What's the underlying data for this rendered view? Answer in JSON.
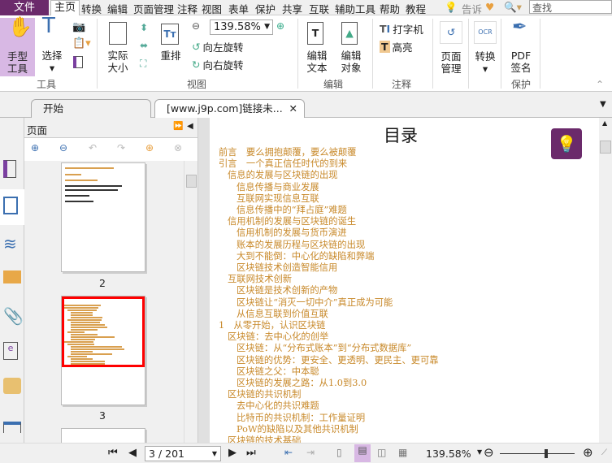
{
  "menu": {
    "file": "文件",
    "home": "主页",
    "items": [
      "转换",
      "编辑",
      "页面管理",
      "注释",
      "视图",
      "表单",
      "保护",
      "共享",
      "互联",
      "辅助工具",
      "帮助",
      "教程"
    ],
    "tell": "告诉",
    "search_placeholder": "查找"
  },
  "ribbon": {
    "hand": "手型工具",
    "select": "选择",
    "group_tools": "工具",
    "actual_size": "实际大小",
    "reflow": "重排",
    "zoom_value": "139.58%",
    "rotate_left": "向左旋转",
    "rotate_right": "向右旋转",
    "group_view": "视图",
    "edit_text": "编辑文本",
    "edit_object": "编辑对象",
    "group_edit": "编辑",
    "typewriter": "打字机",
    "highlight": "高亮",
    "group_comment": "注释",
    "page_manage": "页面管理",
    "convert": "转换",
    "pdf_sign_1": "PDF",
    "pdf_sign_2": "签名",
    "group_protect": "保护"
  },
  "tabs": [
    {
      "label": "开始"
    },
    {
      "label": "[www.j9p.com]链接未..."
    }
  ],
  "panel": {
    "title": "页面",
    "thumbs": [
      {
        "label": "2"
      },
      {
        "label": "3"
      }
    ]
  },
  "doc": {
    "title": "目录",
    "toc": [
      {
        "t": "前言　要么拥抱颠覆，要么被颠覆",
        "l": 0
      },
      {
        "t": "引言　一个真正信任时代的到来",
        "l": 0
      },
      {
        "t": "信息的发展与区块链的出现",
        "l": 1
      },
      {
        "t": "信息传播与商业发展",
        "l": 2
      },
      {
        "t": "互联网实现信息互联",
        "l": 2
      },
      {
        "t": "信息传播中的“拜占庭”难题",
        "l": 2
      },
      {
        "t": "信用机制的发展与区块链的诞生",
        "l": 1
      },
      {
        "t": "信用机制的发展与货币演进",
        "l": 2
      },
      {
        "t": "账本的发展历程与区块链的出现",
        "l": 2
      },
      {
        "t": "大到不能倒：中心化的缺陷和弊端",
        "l": 2
      },
      {
        "t": "区块链技术创造智能信用",
        "l": 2
      },
      {
        "t": "互联网技术创新",
        "l": 1
      },
      {
        "t": "区块链是技术创新的产物",
        "l": 2
      },
      {
        "t": "区块链让“消灭一切中介”真正成为可能",
        "l": 2
      },
      {
        "t": "从信息互联到价值互联",
        "l": 2
      },
      {
        "t": "1　从零开始，认识区块链",
        "l": 0
      },
      {
        "t": "区块链：去中心化的创举",
        "l": 1
      },
      {
        "t": "区块链：从“分布式账本”到“分布式数据库”",
        "l": 2
      },
      {
        "t": "区块链的优势：更安全、更透明、更民主、更可靠",
        "l": 2
      },
      {
        "t": "区块链之父：中本聪",
        "l": 2
      },
      {
        "t": "区块链的发展之路：从1.0到3.0",
        "l": 2
      },
      {
        "t": "区块链的共识机制",
        "l": 1
      },
      {
        "t": "去中心化的共识难题",
        "l": 2
      },
      {
        "t": "比特币的共识机制：工作量证明",
        "l": 2
      },
      {
        "t": "PoW的缺陷以及其他共识机制",
        "l": 2
      },
      {
        "t": "区块链的技术基础",
        "l": 1
      }
    ]
  },
  "status": {
    "page": "3 / 201",
    "zoom": "139.58%"
  },
  "colors": {
    "accent": "#6b2a6b",
    "toc": "#c8892a",
    "selected": "#d8b8e4"
  }
}
